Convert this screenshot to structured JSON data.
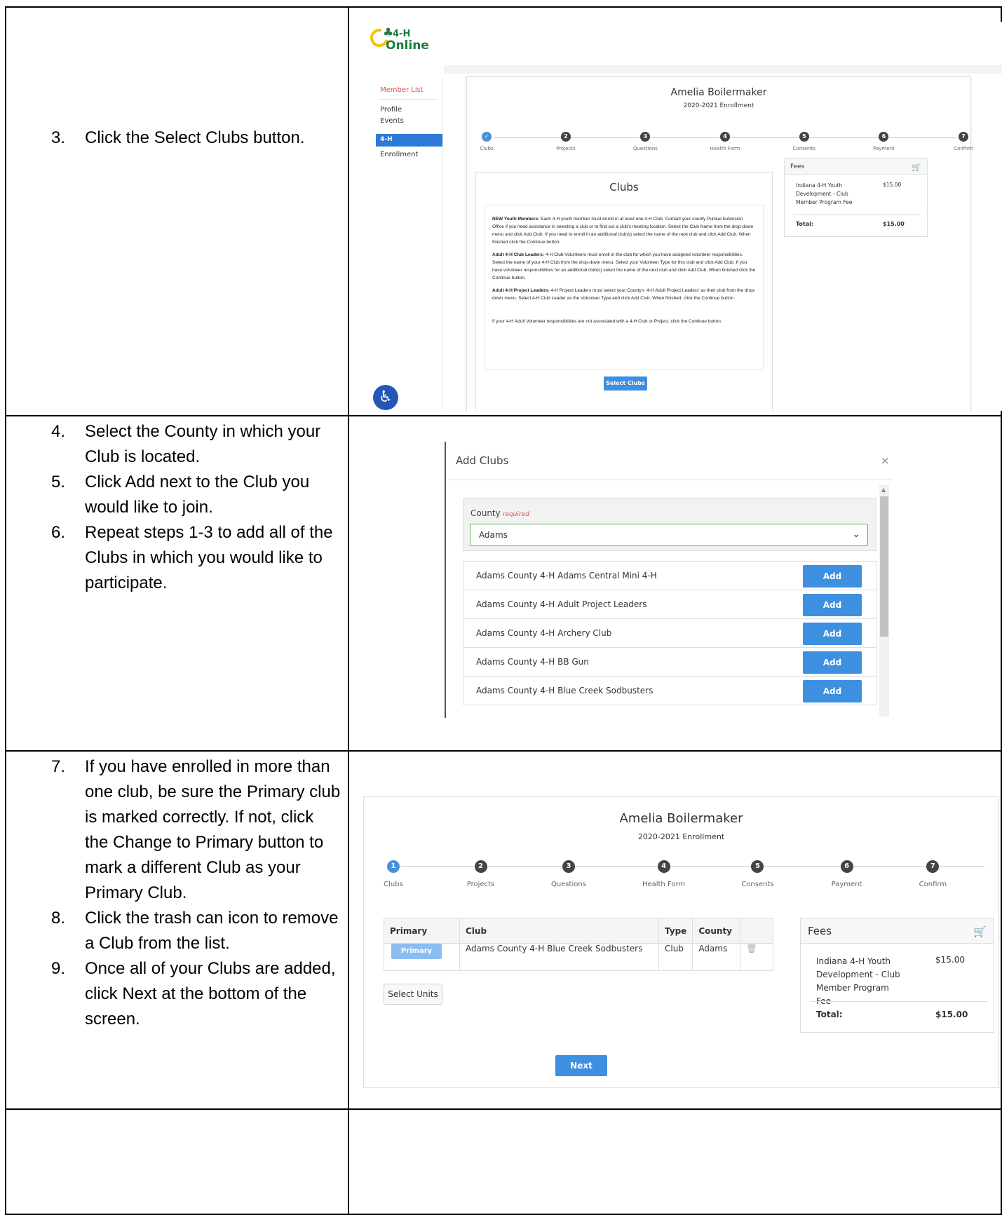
{
  "rows": [
    {
      "steps": [
        {
          "num": "3.",
          "text": "Click the Select Clubs button."
        }
      ]
    },
    {
      "steps": [
        {
          "num": "4.",
          "text": "Select the County in which your Club is located."
        },
        {
          "num": "5.",
          "text": "Click Add next to the Club you would like to join."
        },
        {
          "num": "6.",
          "text": "Repeat steps 1-3 to add all of the Clubs in which you would like to participate."
        }
      ]
    },
    {
      "steps": [
        {
          "num": "7.",
          "text": "If you have enrolled in more than one club, be sure the Primary club is marked correctly. If not, click the Change to Primary button to mark a different Club as your Primary Club."
        },
        {
          "num": "8.",
          "text": "Click the trash can icon to remove a Club from the list."
        },
        {
          "num": "9.",
          "text": "Once all of your Clubs are added, click Next at the bottom of the screen."
        }
      ]
    }
  ],
  "shot1": {
    "logo_top": "4-H",
    "logo_bottom": "Online",
    "nav": {
      "member_list": "Member List",
      "profile": "Profile",
      "events": "Events",
      "section": "4-H",
      "enrollment": "Enrollment"
    },
    "member_name": "Amelia Boilermaker",
    "enrollment_year": "2020-2021 Enrollment",
    "wizard": [
      "Clubs",
      "Projects",
      "Questions",
      "Health Form",
      "Consents",
      "Payment",
      "Confirm"
    ],
    "wizard_nums": [
      "2",
      "3",
      "4",
      "5",
      "6",
      "7"
    ],
    "clubs_title": "Clubs",
    "instructions": [
      {
        "lead": "NEW Youth Members:",
        "body": " Each 4-H youth member must enroll in at least one 4-H Club.  Contact your county Purdue Extension Office if you need assistance in selecting a club or to find out a club's meeting location.  Select the Club Name from the drop-down menu and click Add Club.  If you need to enroll in an additional club(s) select the name of the next club and click Add Club. When finished click the Continue button."
      },
      {
        "lead": "Adult 4-H Club Leaders:",
        "body": " 4-H Club Volunteers must enroll in the club for which you have assigned volunteer responsibilities. Select the name of your 4-H Club from the drop-down menu.  Select your Volunteer Type for this club and click Add Club.  If you have volunteer responsibilities for an additional club(s) select the name of the next club and click Add Club. When finished click the Continue button."
      },
      {
        "lead": "Adult 4-H Project Leaders:",
        "body": " 4-H Project Leaders must select your County's '4-H Adult Project Leaders' as their club from the drop-down menu.  Select 4-H Club Leader as the Volunteer Type and click Add Club.  When finished, click the Continue button."
      }
    ],
    "instruction_last": "If your 4-H Adult Volunteer responsibilities are not associated with a 4-H Club or Project, click the Continue button.",
    "select_clubs_btn": "Select Clubs",
    "fees_title": "Fees",
    "fee_item": "Indiana 4-H Youth Development - Club Member Program Fee",
    "fee_amount": "$15.00",
    "total_label": "Total:",
    "total_amount": "$15.00"
  },
  "shot2": {
    "title": "Add Clubs",
    "close": "×",
    "county_label": "County",
    "required_label": "required",
    "county_value": "Adams",
    "clubs": [
      "Adams County 4-H Adams Central Mini 4-H",
      "Adams County 4-H Adult Project Leaders",
      "Adams County 4-H Archery Club",
      "Adams County 4-H BB Gun",
      "Adams County 4-H Blue Creek Sodbusters"
    ],
    "add_label": "Add"
  },
  "shot3": {
    "member_name": "Amelia Boilermaker",
    "enrollment_year": "2020-2021 Enrollment",
    "wizard": [
      "Clubs",
      "Projects",
      "Questions",
      "Health Form",
      "Consents",
      "Payment",
      "Confirm"
    ],
    "wizard_nums": [
      "1",
      "2",
      "3",
      "4",
      "5",
      "6",
      "7"
    ],
    "table_headers": {
      "primary": "Primary",
      "club": "Club",
      "type": "Type",
      "county": "County"
    },
    "row": {
      "primary_btn": "Primary",
      "club": "Adams County 4-H Blue Creek Sodbusters",
      "type": "Club",
      "county": "Adams"
    },
    "select_units_btn": "Select Units",
    "next_btn": "Next",
    "fees_title": "Fees",
    "fee_item": "Indiana 4-H Youth Development - Club Member Program Fee",
    "fee_amount": "$15.00",
    "total_label": "Total:",
    "total_amount": "$15.00"
  }
}
